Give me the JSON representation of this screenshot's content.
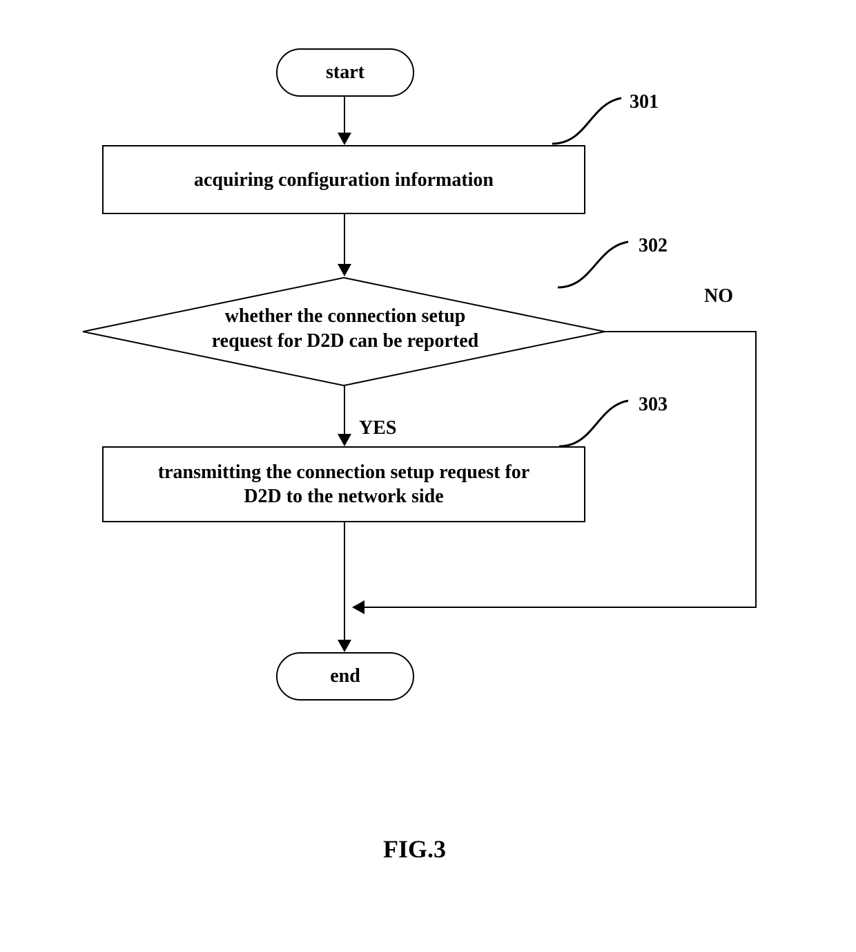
{
  "chart_data": {
    "type": "flowchart",
    "nodes": [
      {
        "id": "start",
        "shape": "terminator",
        "label": "start"
      },
      {
        "id": "301",
        "shape": "process",
        "tag": "301",
        "label": "acquiring configuration information"
      },
      {
        "id": "302",
        "shape": "decision",
        "tag": "302",
        "label": "whether the connection setup request for D2D can be reported"
      },
      {
        "id": "303",
        "shape": "process",
        "tag": "303",
        "label": "transmitting the connection setup request for D2D to the network side"
      },
      {
        "id": "end",
        "shape": "terminator",
        "label": "end"
      }
    ],
    "edges": [
      {
        "from": "start",
        "to": "301"
      },
      {
        "from": "301",
        "to": "302"
      },
      {
        "from": "302",
        "to": "303",
        "label": "YES"
      },
      {
        "from": "303",
        "to": "end"
      },
      {
        "from": "302",
        "to": "end",
        "label": "NO"
      }
    ],
    "title": "FIG.3"
  },
  "labels": {
    "start": "start",
    "end": "end",
    "yes": "YES",
    "no": "NO",
    "tag301": "301",
    "tag302": "302",
    "tag303": "303",
    "step301": "acquiring configuration information",
    "step302a": "whether the connection setup",
    "step302b": "request for D2D can be reported",
    "step303a": "transmitting the connection setup request for",
    "step303b": "D2D to the network side",
    "figcaption": "FIG.3"
  }
}
